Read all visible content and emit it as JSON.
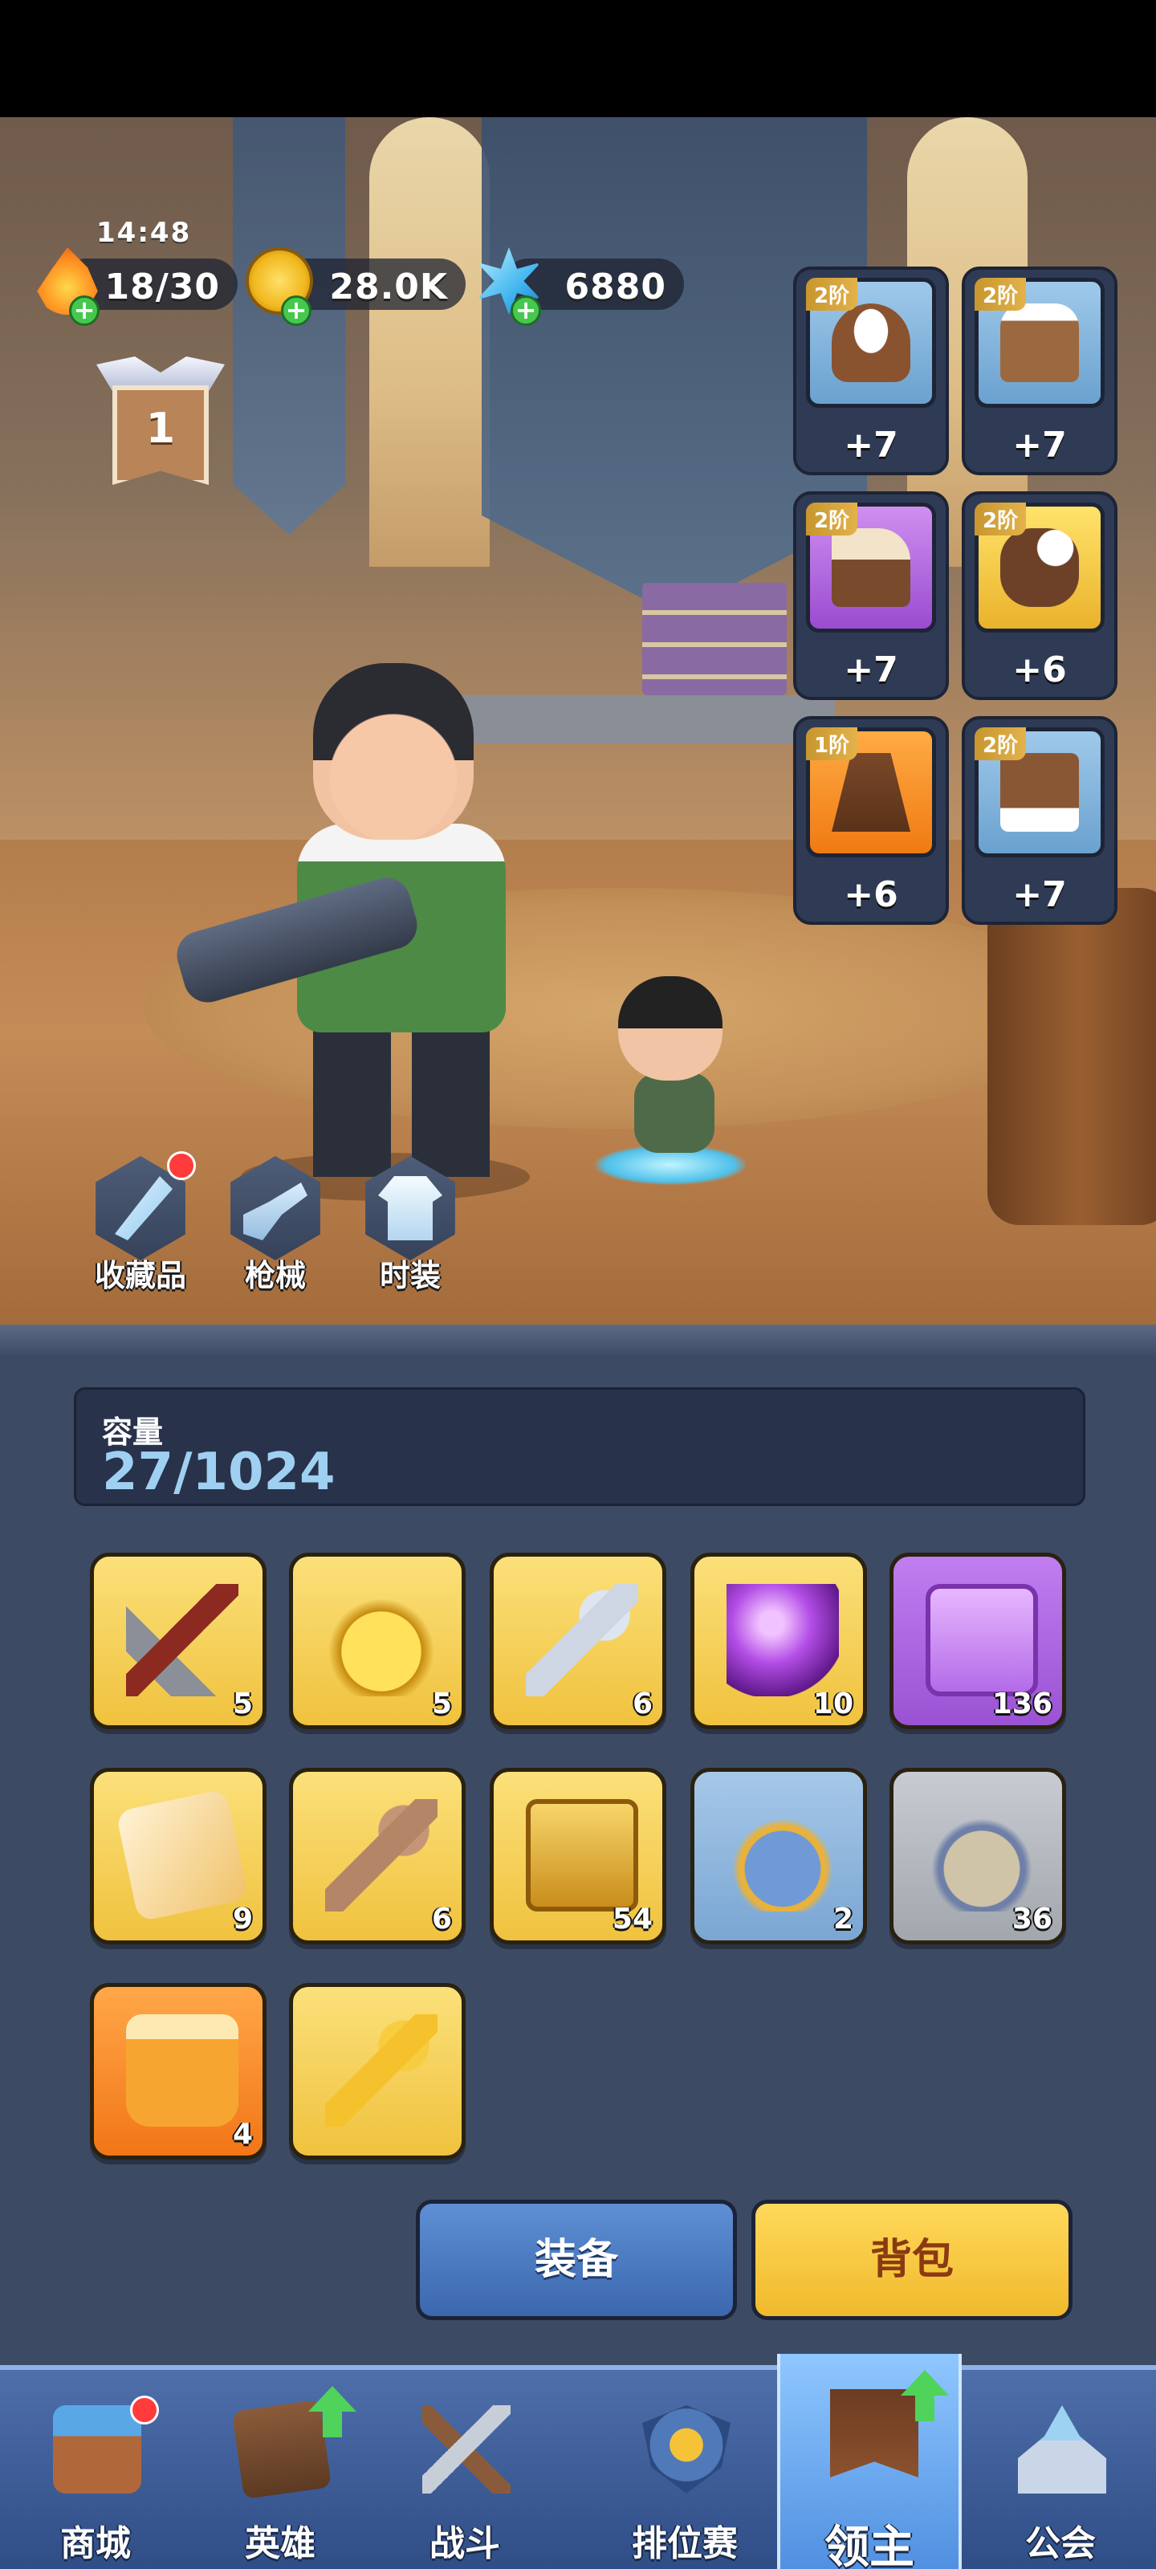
{
  "status": {
    "time": "14:48"
  },
  "resources": {
    "energy": "18/30",
    "gold": "28.0K",
    "gems": "6880"
  },
  "rank": {
    "level": "1"
  },
  "equipment": [
    {
      "slot": "hat",
      "tier": "2阶",
      "bonus": "+7",
      "rarity": "blue"
    },
    {
      "slot": "coat",
      "tier": "2阶",
      "bonus": "+7",
      "rarity": "blue"
    },
    {
      "slot": "boots",
      "tier": "2阶",
      "bonus": "+7",
      "rarity": "purple"
    },
    {
      "slot": "gloves",
      "tier": "2阶",
      "bonus": "+6",
      "rarity": "gold"
    },
    {
      "slot": "cape",
      "tier": "1阶",
      "bonus": "+6",
      "rarity": "orange"
    },
    {
      "slot": "pants",
      "tier": "2阶",
      "bonus": "+7",
      "rarity": "blue"
    }
  ],
  "side_buttons": {
    "collection": "收藏品",
    "weapons": "枪械",
    "fashion": "时装"
  },
  "inventory": {
    "capacity_label": "容量",
    "capacity_value": "27/1024",
    "items": [
      {
        "icon": "pickaxe-icon",
        "count": "5",
        "rarity": "gold"
      },
      {
        "icon": "gold-bag-icon",
        "count": "5",
        "rarity": "gold"
      },
      {
        "icon": "silver-key-icon",
        "count": "6",
        "rarity": "gold"
      },
      {
        "icon": "purple-orb-icon",
        "count": "10",
        "rarity": "gold"
      },
      {
        "icon": "purple-chest-icon",
        "count": "136",
        "rarity": "purple"
      },
      {
        "icon": "scroll-icon",
        "count": "9",
        "rarity": "gold"
      },
      {
        "icon": "bronze-key-icon",
        "count": "6",
        "rarity": "gold"
      },
      {
        "icon": "gold-chest-icon",
        "count": "54",
        "rarity": "gold"
      },
      {
        "icon": "mystery-bag-blue-icon",
        "count": "2",
        "rarity": "blue"
      },
      {
        "icon": "mystery-bag-gray-icon",
        "count": "36",
        "rarity": "gray"
      },
      {
        "icon": "honey-jar-icon",
        "count": "4",
        "rarity": "orange"
      },
      {
        "icon": "gold-key-icon",
        "count": "",
        "rarity": "gold"
      }
    ],
    "equip_button": "装备",
    "bag_button": "背包"
  },
  "nav": {
    "shop": "商城",
    "heroes": "英雄",
    "battle": "战斗",
    "ranked": "排位赛",
    "lord": "领主",
    "guild": "公会"
  }
}
